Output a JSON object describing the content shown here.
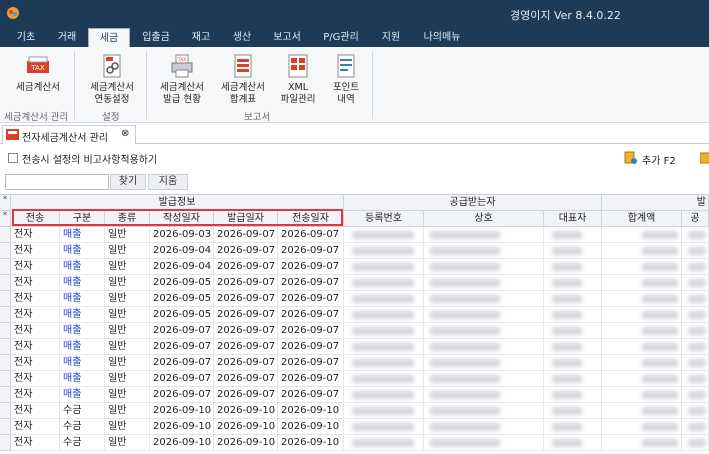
{
  "app": {
    "title": "경영이지 Ver 8.4.0.22"
  },
  "menu": [
    "기초",
    "거래",
    "세금",
    "입출금",
    "재고",
    "생산",
    "보고서",
    "P/G관리",
    "지원",
    "나의메뉴"
  ],
  "menu_active_index": 2,
  "ribbon": {
    "buttons": [
      {
        "lines": [
          "세금계산서",
          ""
        ],
        "icon": "tax-invoice-icon"
      },
      {
        "lines": [
          "세금계산서",
          "연동설정"
        ],
        "icon": "link-settings-icon"
      },
      {
        "lines": [
          "세금계산서",
          "발급 현황"
        ],
        "icon": "printer-tax-icon"
      },
      {
        "lines": [
          "세금계산서",
          "합계표"
        ],
        "icon": "summary-sheet-icon"
      },
      {
        "lines": [
          "XML",
          "파일관리"
        ],
        "icon": "xml-file-icon"
      },
      {
        "lines": [
          "포인트",
          "내역"
        ],
        "icon": "point-history-icon"
      }
    ],
    "groups": [
      "세금계산서 관리",
      "설정",
      "보고서"
    ]
  },
  "doc_tab": {
    "label": "전자세금계산서 관리",
    "close": "⊗"
  },
  "options": {
    "checkbox_label": "전송시 설정의 비고사항적용하기",
    "add_label": "추가 F2"
  },
  "search": {
    "placeholder": "",
    "find_label": "찾기",
    "clear_label": "지움"
  },
  "grid": {
    "group_headers": [
      "발급정보",
      "공급받는자",
      "발"
    ],
    "columns": [
      "전송",
      "구분",
      "종류",
      "작성일자",
      "발급일자",
      "전송일자",
      "등록번호",
      "상호",
      "대표자",
      "합계액",
      "공"
    ],
    "row_marker": "*",
    "rows": [
      [
        "전자",
        "매출",
        "일반",
        "2026-09-03",
        "2026-09-07",
        "2026-09-07"
      ],
      [
        "전자",
        "매출",
        "일반",
        "2026-09-04",
        "2026-09-07",
        "2026-09-07"
      ],
      [
        "전자",
        "매출",
        "일반",
        "2026-09-04",
        "2026-09-07",
        "2026-09-07"
      ],
      [
        "전자",
        "매출",
        "일반",
        "2026-09-05",
        "2026-09-07",
        "2026-09-07"
      ],
      [
        "전자",
        "매출",
        "일반",
        "2026-09-05",
        "2026-09-07",
        "2026-09-07"
      ],
      [
        "전자",
        "매출",
        "일반",
        "2026-09-05",
        "2026-09-07",
        "2026-09-07"
      ],
      [
        "전자",
        "매출",
        "일반",
        "2026-09-07",
        "2026-09-07",
        "2026-09-07"
      ],
      [
        "전자",
        "매출",
        "일반",
        "2026-09-07",
        "2026-09-07",
        "2026-09-07"
      ],
      [
        "전자",
        "매출",
        "일반",
        "2026-09-07",
        "2026-09-07",
        "2026-09-07"
      ],
      [
        "전자",
        "매출",
        "일반",
        "2026-09-07",
        "2026-09-07",
        "2026-09-07"
      ],
      [
        "전자",
        "매출",
        "일반",
        "2026-09-07",
        "2026-09-07",
        "2026-09-07"
      ],
      [
        "전자",
        "수금",
        "일반",
        "2026-09-10",
        "2026-09-10",
        "2026-09-10"
      ],
      [
        "전자",
        "수금",
        "일반",
        "2026-09-10",
        "2026-09-10",
        "2026-09-10"
      ],
      [
        "전자",
        "수금",
        "일반",
        "2026-09-10",
        "2026-09-10",
        "2026-09-10"
      ]
    ]
  },
  "colors": {
    "titlebar": "#1d3a57",
    "sales_text": "#1a3fd6",
    "highlight_border": "#e0383a"
  }
}
